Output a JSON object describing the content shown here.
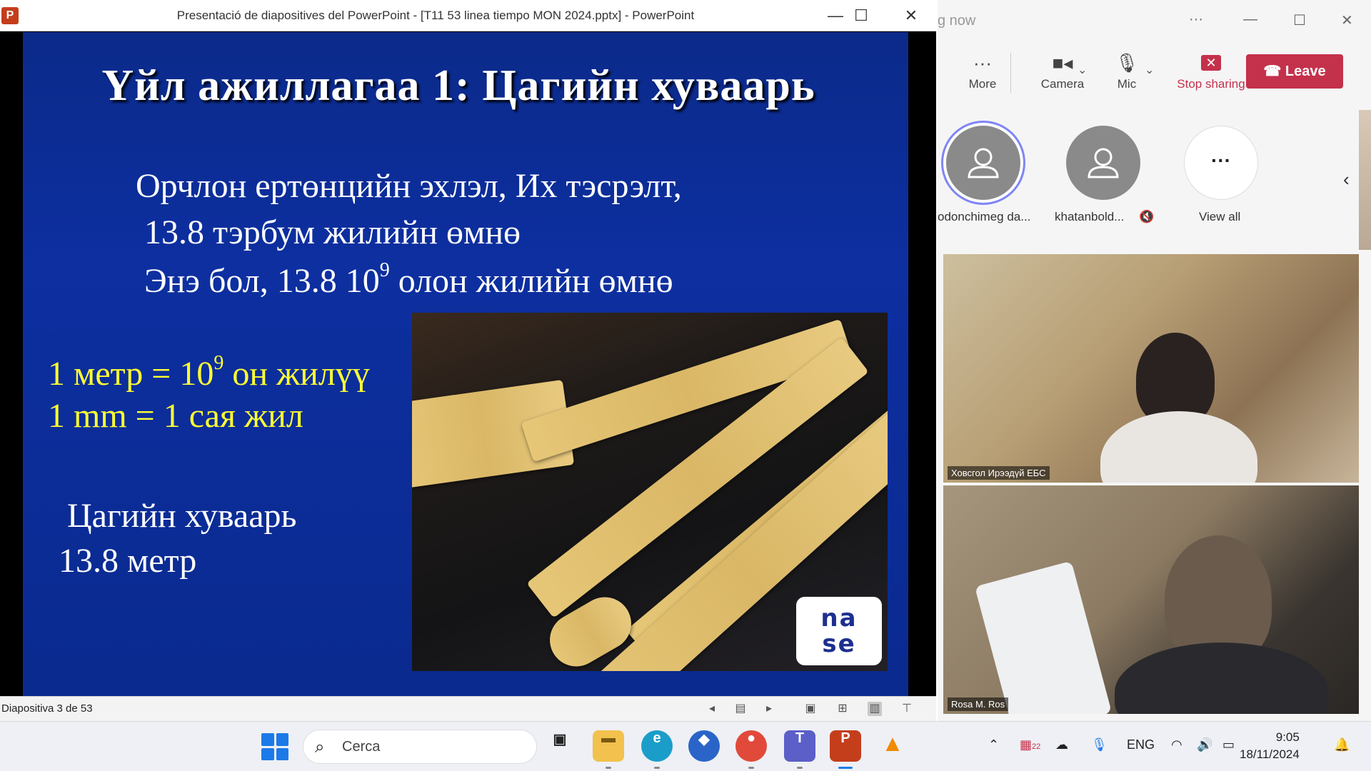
{
  "ppt": {
    "app_icon": "P",
    "title": "Presentació de diapositives del PowerPoint - [T11 53 linea tiempo MON 2024.pptx] - PowerPoint",
    "slide": {
      "title": "Үйл ажиллагаа 1: Цагийн хуваарь",
      "line1": "Орчлон ертөнцийн эхлэл, Их тэсрэлт,",
      "line2": "13.8 тэрбум жилийн өмнө",
      "line3_pre": "Энэ бол, 13.8 10",
      "line3_sup": "9",
      "line3_post": " олон жилийн өмнө",
      "yline1_pre": "1 метр = 10",
      "yline1_sup": "9",
      "yline1_post": " он жилүү",
      "yline2": "1 mm = 1 сая жил",
      "line4": "Цагийн хуваарь",
      "line5": "13.8 метр",
      "logo": [
        "na",
        "se"
      ]
    },
    "status": {
      "slide_counter": "Diapositiva 3 de 53"
    }
  },
  "teams": {
    "title": "g now",
    "toolbar": {
      "more": "More",
      "camera": "Camera",
      "mic": "Mic",
      "stop_sharing": "Stop sharing",
      "leave": "Leave"
    },
    "participants": [
      {
        "name": "odonchimeg da...",
        "speaking": true
      },
      {
        "name": "khatanbold...",
        "muted": true
      }
    ],
    "view_all": "View all",
    "videos": [
      {
        "label": "Ховсгол Ирээдүй ЕБС"
      },
      {
        "label": "Rosa M. Ros"
      }
    ]
  },
  "taskbar": {
    "search_placeholder": "Cerca",
    "language": "ENG",
    "time": "9:05",
    "date": "18/11/2024",
    "calendar_badge": "22"
  },
  "colors": {
    "slide_bg": "#0d2fa0",
    "slide_yellow": "#ffff33",
    "teams_red": "#c4314b",
    "speaking_ring": "#7f85f5"
  }
}
